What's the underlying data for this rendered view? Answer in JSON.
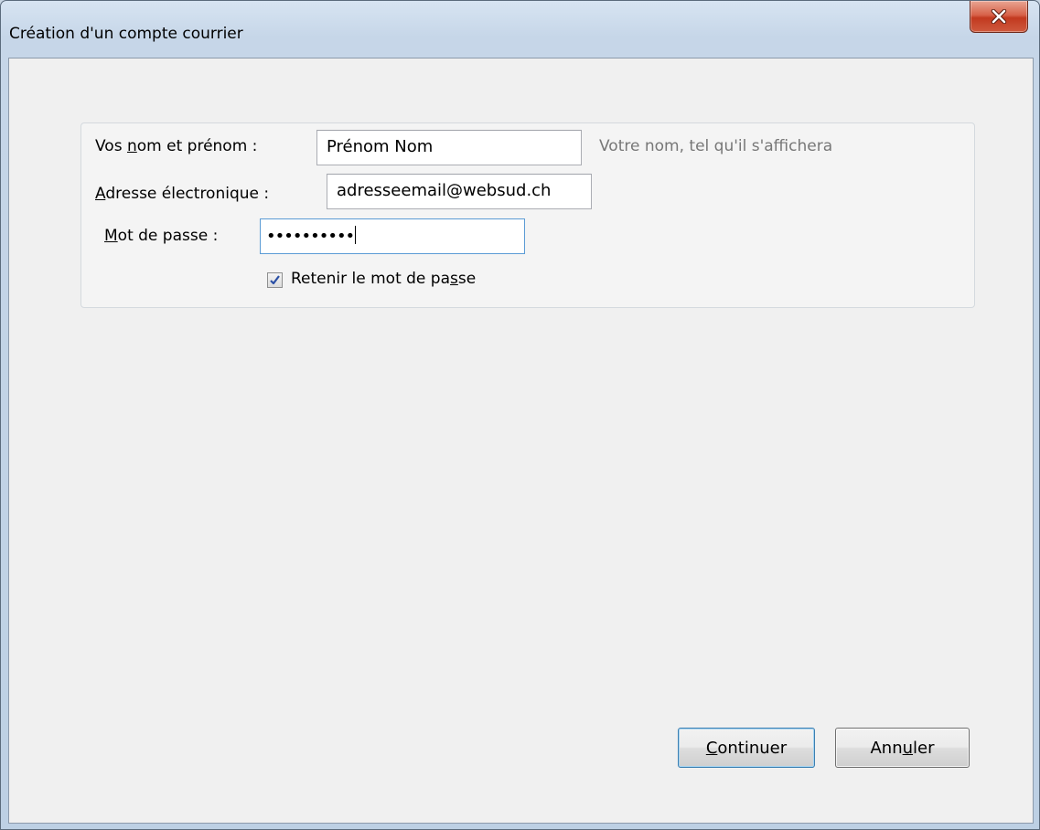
{
  "window": {
    "title": "Création d'un compte courrier"
  },
  "form": {
    "name": {
      "label_pre": "Vos ",
      "label_key": "n",
      "label_post": "om et prénom :",
      "value": "Prénom Nom",
      "hint": "Votre nom, tel qu'il s'affichera"
    },
    "email": {
      "label_pre": "",
      "label_key": "A",
      "label_post": "dresse électronique :",
      "value": "adresseemail@websud.ch"
    },
    "password": {
      "label_pre": "",
      "label_key": "M",
      "label_post": "ot de passe :",
      "value": "••••••••••"
    },
    "remember": {
      "label_pre": "Retenir le mot de pa",
      "label_key": "s",
      "label_post": "se",
      "checked": true
    }
  },
  "buttons": {
    "continue": {
      "label_pre": "",
      "label_key": "C",
      "label_post": "ontinuer"
    },
    "cancel": {
      "label_pre": "Ann",
      "label_key": "u",
      "label_post": "ler"
    }
  },
  "colors": {
    "accent": "#3c7fb1",
    "close_button": "#c2391f"
  }
}
